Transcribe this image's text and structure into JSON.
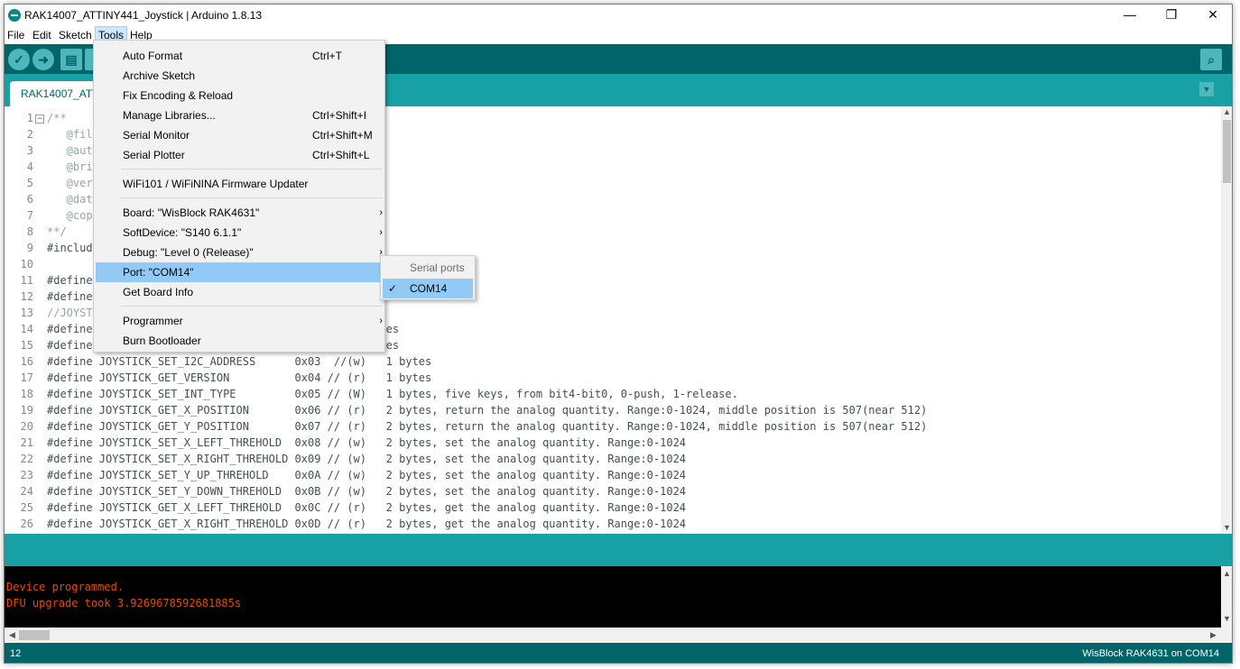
{
  "window": {
    "title": "RAK14007_ATTINY441_Joystick | Arduino 1.8.13",
    "controls": {
      "minimize": "—",
      "restore": "❐",
      "close": "✕"
    }
  },
  "menubar": [
    "File",
    "Edit",
    "Sketch",
    "Tools",
    "Help"
  ],
  "toolbar": {
    "icons": [
      "verify-icon",
      "upload-icon",
      "new-icon",
      "open-icon",
      "serial-monitor-icon"
    ]
  },
  "tab": {
    "label": "RAK14007_ATTINY441_Joystick"
  },
  "code_lines": [
    {
      "n": "1",
      "t": "/**"
    },
    {
      "n": "2",
      "t": "   @file RAK14007_ATTINY441_Joystick.ino"
    },
    {
      "n": "3",
      "t": "   @author rakwireless.com"
    },
    {
      "n": "4",
      "t": "   @brief Joystick example."
    },
    {
      "n": "5",
      "t": "   @version 0.1"
    },
    {
      "n": "6",
      "t": "   @date 2021-09-02"
    },
    {
      "n": "7",
      "t": "   @copyright Copyright (c) 2021"
    },
    {
      "n": "8",
      "t": "**/"
    },
    {
      "n": "9",
      "t": "#include <Wire.h>"
    },
    {
      "n": "10",
      "t": ""
    },
    {
      "n": "11",
      "t": "#define JOYSTICK_ADDRESS         0x5A"
    },
    {
      "n": "12",
      "t": "#define JOYSTICK_INT_PIN         WB_IO6"
    },
    {
      "n": "13",
      "t": "//JOYSTICK REGISTER"
    },
    {
      "n": "14",
      "t": "#define JOYSTICK_GET_KEY_STATE   0x01 // (r)   2 bytes"
    },
    {
      "n": "15",
      "t": "#define JOYSTICK_GET_I2C_ADDRESS 0x02 // (r)   1 bytes"
    },
    {
      "n": "16",
      "t": "#define JOYSTICK_SET_I2C_ADDRESS      0x03  //(w)   1 bytes"
    },
    {
      "n": "17",
      "t": "#define JOYSTICK_GET_VERSION          0x04 // (r)   1 bytes"
    },
    {
      "n": "18",
      "t": "#define JOYSTICK_SET_INT_TYPE         0x05 // (W)   1 bytes, five keys, from bit4-bit0, 0-push, 1-release."
    },
    {
      "n": "19",
      "t": "#define JOYSTICK_GET_X_POSITION       0x06 // (r)   2 bytes, return the analog quantity. Range:0-1024, middle position is 507(near 512)"
    },
    {
      "n": "20",
      "t": "#define JOYSTICK_GET_Y_POSITION       0x07 // (r)   2 bytes, return the analog quantity. Range:0-1024, middle position is 507(near 512)"
    },
    {
      "n": "21",
      "t": "#define JOYSTICK_SET_X_LEFT_THREHOLD  0x08 // (w)   2 bytes, set the analog quantity. Range:0-1024"
    },
    {
      "n": "22",
      "t": "#define JOYSTICK_SET_X_RIGHT_THREHOLD 0x09 // (w)   2 bytes, set the analog quantity. Range:0-1024"
    },
    {
      "n": "23",
      "t": "#define JOYSTICK_SET_Y_UP_THREHOLD    0x0A // (w)   2 bytes, set the analog quantity. Range:0-1024"
    },
    {
      "n": "24",
      "t": "#define JOYSTICK_SET_Y_DOWN_THREHOLD  0x0B // (w)   2 bytes, set the analog quantity. Range:0-1024"
    },
    {
      "n": "25",
      "t": "#define JOYSTICK_GET_X_LEFT_THREHOLD  0x0C // (r)   2 bytes, get the analog quantity. Range:0-1024"
    },
    {
      "n": "26",
      "t": "#define JOYSTICK_GET_X_RIGHT_THREHOLD 0x0D // (r)   2 bytes, get the analog quantity. Range:0-1024"
    }
  ],
  "console": {
    "lines": [
      "Device programmed.",
      "DFU upgrade took 3.9269678592681885s"
    ]
  },
  "footer": {
    "line": "12",
    "board_port": "WisBlock RAK4631 on COM14"
  },
  "tools_menu": [
    {
      "label": "Auto Format",
      "shortcut": "Ctrl+T"
    },
    {
      "label": "Archive Sketch",
      "shortcut": ""
    },
    {
      "label": "Fix Encoding & Reload",
      "shortcut": ""
    },
    {
      "label": "Manage Libraries...",
      "shortcut": "Ctrl+Shift+I"
    },
    {
      "label": "Serial Monitor",
      "shortcut": "Ctrl+Shift+M"
    },
    {
      "label": "Serial Plotter",
      "shortcut": "Ctrl+Shift+L"
    },
    {
      "sep": true
    },
    {
      "label": "WiFi101 / WiFiNINA Firmware Updater",
      "shortcut": ""
    },
    {
      "sep": true
    },
    {
      "label": "Board: \"WisBlock RAK4631\"",
      "submenu": true
    },
    {
      "label": "SoftDevice: \"S140  6.1.1\"",
      "submenu": true
    },
    {
      "label": "Debug: \"Level 0 (Release)\"",
      "submenu": true
    },
    {
      "label": "Port: \"COM14\"",
      "submenu": true,
      "highlighted": true
    },
    {
      "label": "Get Board Info",
      "shortcut": ""
    },
    {
      "sep": true
    },
    {
      "label": "Programmer",
      "submenu": true
    },
    {
      "label": "Burn Bootloader",
      "shortcut": ""
    }
  ],
  "port_submenu": {
    "header": "Serial ports",
    "items": [
      {
        "label": "COM14",
        "checked": true
      }
    ]
  },
  "colors": {
    "toolbar": "#006468",
    "tabbar": "#17a1a5",
    "console_text": "#e34c00",
    "menu_highlight": "#91c9f7"
  }
}
